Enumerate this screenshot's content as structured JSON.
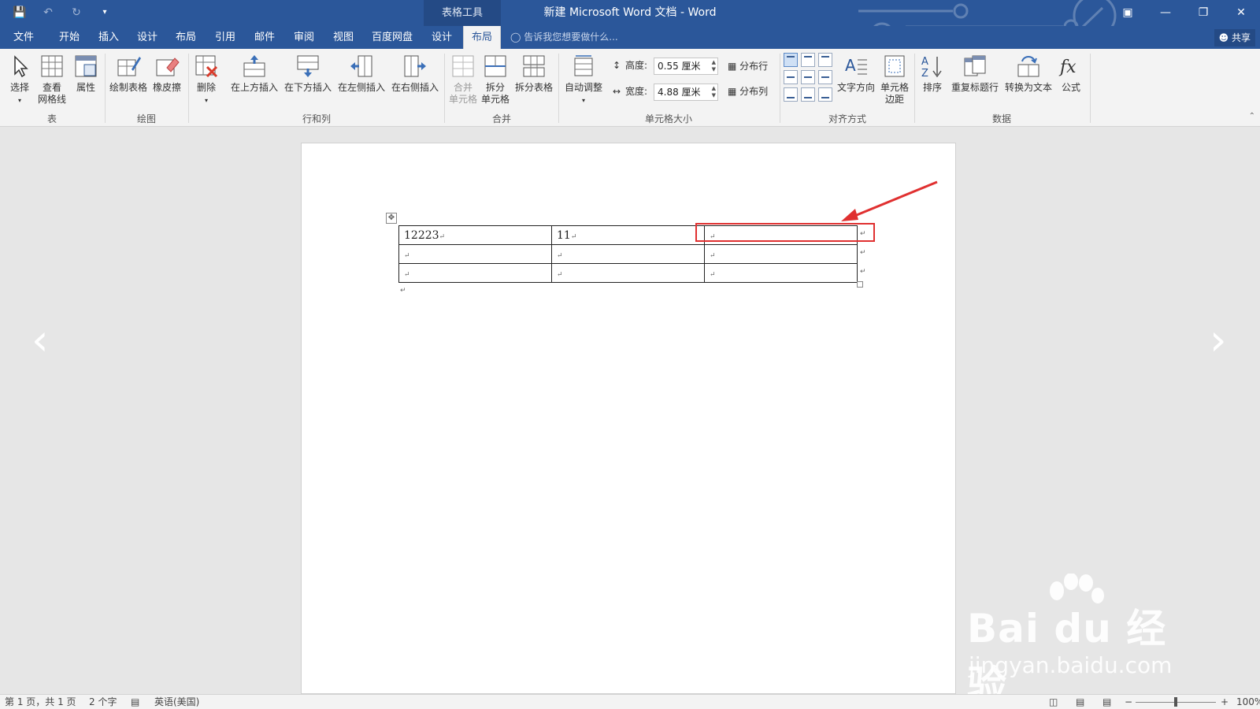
{
  "titlebar": {
    "context_tab": "表格工具",
    "doc_title": "新建 Microsoft Word 文档 - Word"
  },
  "tabs": [
    {
      "label": "文件"
    },
    {
      "label": "开始"
    },
    {
      "label": "插入"
    },
    {
      "label": "设计"
    },
    {
      "label": "布局"
    },
    {
      "label": "引用"
    },
    {
      "label": "邮件"
    },
    {
      "label": "审阅"
    },
    {
      "label": "视图"
    },
    {
      "label": "百度网盘"
    },
    {
      "label": "设计"
    },
    {
      "label": "布局"
    }
  ],
  "tell_me": "告诉我您想要做什么...",
  "share": "共享",
  "ribbon": {
    "select": "选择",
    "view_gridlines_1": "查看",
    "view_gridlines_2": "网格线",
    "properties": "属性",
    "draw_table": "绘制表格",
    "eraser": "橡皮擦",
    "delete": "删除",
    "insert_above": "在上方插入",
    "insert_below": "在下方插入",
    "insert_left": "在左侧插入",
    "insert_right": "在右侧插入",
    "merge_cells_1": "合并",
    "merge_cells_2": "单元格",
    "split_cells_1": "拆分",
    "split_cells_2": "单元格",
    "split_table": "拆分表格",
    "autofit": "自动调整",
    "height_label": "高度:",
    "height_value": "0.55 厘米",
    "width_label": "宽度:",
    "width_value": "4.88 厘米",
    "distribute_rows": "分布行",
    "distribute_cols": "分布列",
    "text_direction": "文字方向",
    "cell_margins_1": "单元格",
    "cell_margins_2": "边距",
    "sort": "排序",
    "repeat_header": "重复标题行",
    "convert_text": "转换为文本",
    "formula": "公式",
    "groups": {
      "table": "表",
      "draw": "绘图",
      "rows_cols": "行和列",
      "merge": "合并",
      "cell_size": "单元格大小",
      "alignment": "对齐方式",
      "data": "数据"
    }
  },
  "table": {
    "rows": [
      [
        "12223",
        "11",
        ""
      ],
      [
        "",
        "",
        ""
      ],
      [
        "",
        "",
        ""
      ]
    ]
  },
  "watermark": {
    "logo": "Bai du 经验",
    "url": "jingyan.baidu.com"
  },
  "status": {
    "page": "第 1 页，共 1 页",
    "words": "2 个字",
    "language": "英语(美国)",
    "zoom": "100%"
  },
  "colors": {
    "title_bg": "#2b579a",
    "highlight": "#e03030"
  }
}
